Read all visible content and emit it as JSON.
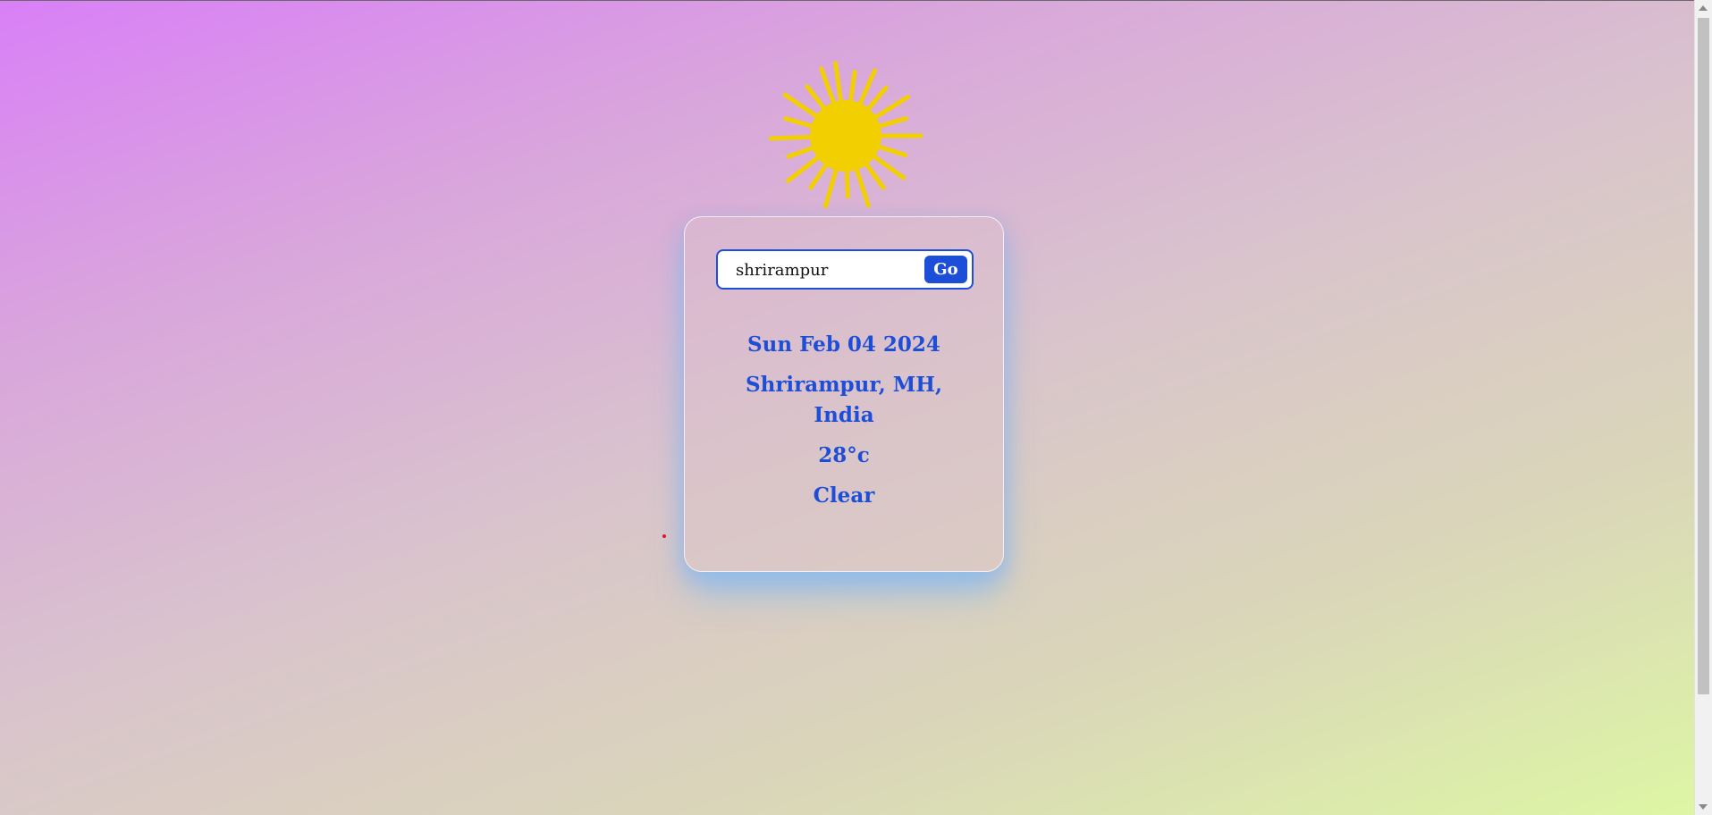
{
  "search": {
    "value": "shrirampur",
    "button_label": "Go"
  },
  "weather": {
    "date": "Sun Feb 04 2024",
    "location": "Shrirampur, MH, India",
    "temperature": "28°c",
    "condition": "Clear"
  },
  "icons": {
    "weather_icon": "sun-icon"
  },
  "colors": {
    "accent": "#1d4ed8",
    "sun": "#f2cf00",
    "background_start": "#d97ff7",
    "background_end": "#ddf6a4"
  }
}
